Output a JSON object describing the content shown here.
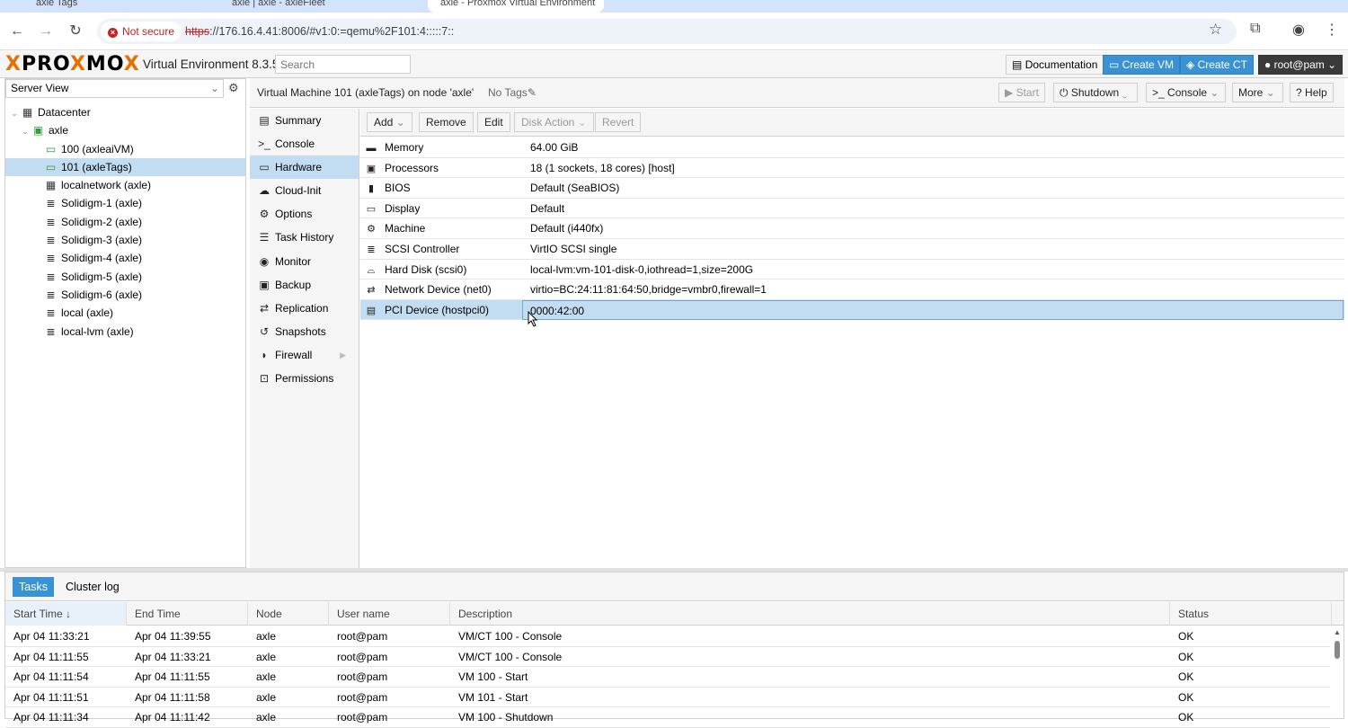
{
  "browser": {
    "tabs": [
      "axle Tags",
      "axle | axle - axleFleet",
      "axle - Proxmox Virtual Environment"
    ],
    "security_label": "Not secure",
    "url_scheme": "https",
    "url_rest": "://176.16.4.41:8006/#v1:0:=qemu%2F101:4:::::7::"
  },
  "header": {
    "logo_text_1": "PRO",
    "logo_x": "X",
    "logo_text_2": "MO",
    "logo_full": "XPROXMOX",
    "version": "Virtual Environment 8.3.5",
    "search_placeholder": "Search",
    "documentation": "Documentation",
    "create_vm": "Create VM",
    "create_ct": "Create CT",
    "user": "root@pam"
  },
  "server_view": {
    "label": "Server View",
    "tree": [
      {
        "label": "Datacenter",
        "icon": "datacenter-icon",
        "level": 0
      },
      {
        "label": "axle",
        "icon": "node-icon",
        "level": 1
      },
      {
        "label": "100 (axleaiVM)",
        "icon": "vm-running-icon",
        "level": 2
      },
      {
        "label": "101 (axleTags)",
        "icon": "vm-running-icon",
        "level": 2,
        "selected": true
      },
      {
        "label": "localnetwork (axle)",
        "icon": "network-grid-icon",
        "level": 2
      },
      {
        "label": "Solidigm-1 (axle)",
        "icon": "storage-icon",
        "level": 2
      },
      {
        "label": "Solidigm-2 (axle)",
        "icon": "storage-icon",
        "level": 2
      },
      {
        "label": "Solidigm-3 (axle)",
        "icon": "storage-icon",
        "level": 2
      },
      {
        "label": "Solidigm-4 (axle)",
        "icon": "storage-icon",
        "level": 2
      },
      {
        "label": "Solidigm-5 (axle)",
        "icon": "storage-icon",
        "level": 2
      },
      {
        "label": "Solidigm-6 (axle)",
        "icon": "storage-icon",
        "level": 2
      },
      {
        "label": "local (axle)",
        "icon": "storage-icon",
        "level": 2
      },
      {
        "label": "local-lvm (axle)",
        "icon": "storage-icon",
        "level": 2
      }
    ]
  },
  "vm": {
    "title": "Virtual Machine 101 (axleTags) on node 'axle'",
    "tags": "No Tags",
    "start": "Start",
    "shutdown": "Shutdown",
    "console": "Console",
    "more": "More",
    "help": "Help"
  },
  "subnav": [
    {
      "label": "Summary",
      "icon": "summary-icon"
    },
    {
      "label": "Console",
      "icon": "console-icon"
    },
    {
      "label": "Hardware",
      "icon": "hardware-icon",
      "selected": true
    },
    {
      "label": "Cloud-Init",
      "icon": "cloud-icon"
    },
    {
      "label": "Options",
      "icon": "gear-icon"
    },
    {
      "label": "Task History",
      "icon": "list-icon"
    },
    {
      "label": "Monitor",
      "icon": "eye-icon"
    },
    {
      "label": "Backup",
      "icon": "floppy-icon"
    },
    {
      "label": "Replication",
      "icon": "retweet-icon"
    },
    {
      "label": "Snapshots",
      "icon": "history-icon"
    },
    {
      "label": "Firewall",
      "icon": "shield-icon",
      "has_arrow": true
    },
    {
      "label": "Permissions",
      "icon": "unlock-icon"
    }
  ],
  "hardware_toolbar": {
    "add": "Add",
    "remove": "Remove",
    "edit": "Edit",
    "disk_action": "Disk Action",
    "revert": "Revert"
  },
  "hardware": [
    {
      "key": "Memory",
      "value": "64.00 GiB",
      "icon": "memory-icon"
    },
    {
      "key": "Processors",
      "value": "18 (1 sockets, 18 cores) [host]",
      "icon": "cpu-icon"
    },
    {
      "key": "BIOS",
      "value": "Default (SeaBIOS)",
      "icon": "bios-icon"
    },
    {
      "key": "Display",
      "value": "Default",
      "icon": "desktop-icon"
    },
    {
      "key": "Machine",
      "value": "Default (i440fx)",
      "icon": "cogs-icon"
    },
    {
      "key": "SCSI Controller",
      "value": "VirtIO SCSI single",
      "icon": "database-icon"
    },
    {
      "key": "Hard Disk (scsi0)",
      "value": "local-lvm:vm-101-disk-0,iothread=1,size=200G",
      "icon": "hdd-icon"
    },
    {
      "key": "Network Device (net0)",
      "value": "virtio=BC:24:11:81:64:50,bridge=vmbr0,firewall=1",
      "icon": "exchange-icon"
    },
    {
      "key": "PCI Device (hostpci0)",
      "value": "0000:42:00",
      "icon": "pci-icon",
      "selected": true
    }
  ],
  "tasks_panel": {
    "tabs": [
      "Tasks",
      "Cluster log"
    ],
    "columns": [
      "Start Time",
      "End Time",
      "Node",
      "User name",
      "Description",
      "Status"
    ],
    "rows": [
      [
        "Apr 04 11:33:21",
        "Apr 04 11:39:55",
        "axle",
        "root@pam",
        "VM/CT 100 - Console",
        "OK"
      ],
      [
        "Apr 04 11:11:55",
        "Apr 04 11:33:21",
        "axle",
        "root@pam",
        "VM/CT 100 - Console",
        "OK"
      ],
      [
        "Apr 04 11:11:54",
        "Apr 04 11:11:55",
        "axle",
        "root@pam",
        "VM 100 - Start",
        "OK"
      ],
      [
        "Apr 04 11:11:51",
        "Apr 04 11:11:58",
        "axle",
        "root@pam",
        "VM 101 - Start",
        "OK"
      ],
      [
        "Apr 04 11:11:34",
        "Apr 04 11:11:42",
        "axle",
        "root@pam",
        "VM 100 - Shutdown",
        "OK"
      ]
    ]
  }
}
